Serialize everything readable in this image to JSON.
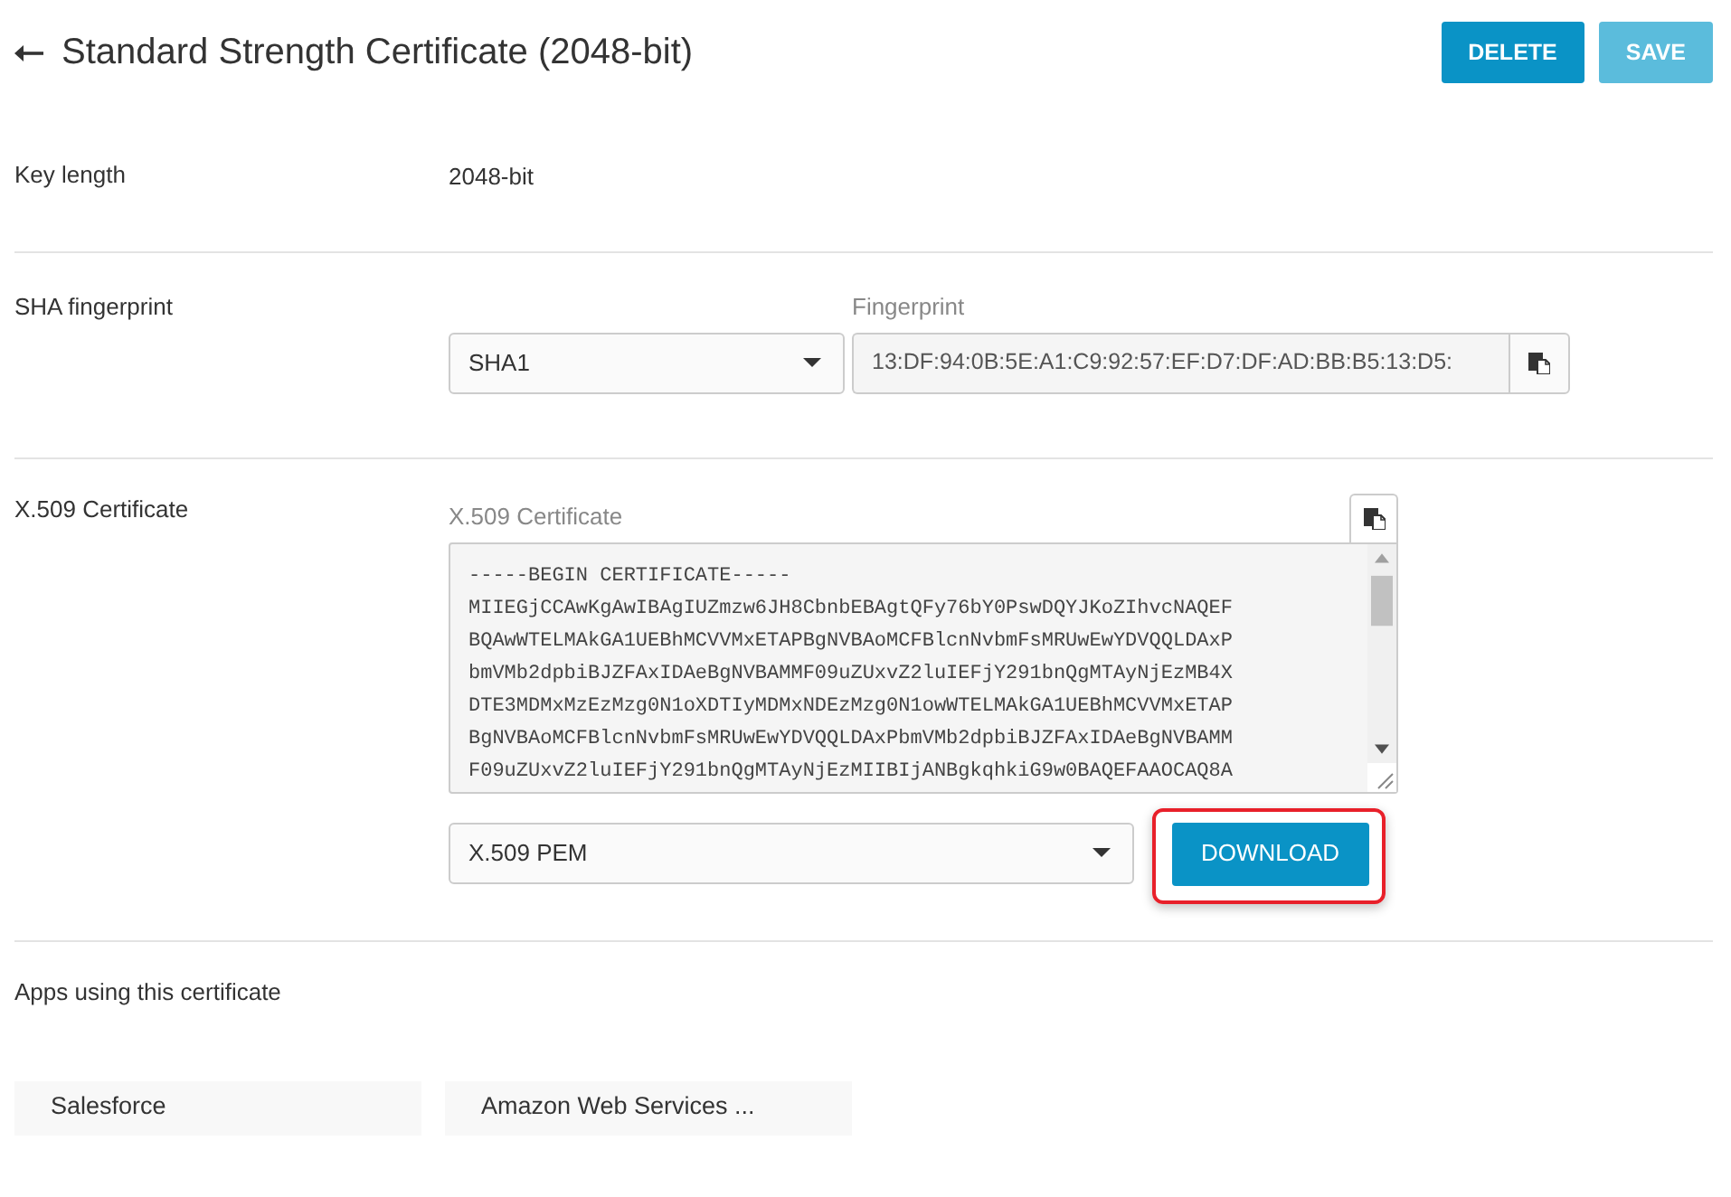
{
  "header": {
    "title": "Standard Strength Certificate (2048-bit)",
    "buttons": [
      {
        "label": "DELETE",
        "disabled": false
      },
      {
        "label": "SAVE",
        "disabled": true
      }
    ]
  },
  "sections": [
    {
      "kind": "value",
      "label": "Key length",
      "value": "2048-bit"
    },
    {
      "kind": "fingerprint",
      "label": "SHA fingerprint",
      "algorithm": "SHA1",
      "field_label": "Fingerprint",
      "fingerprint": "13:DF:94:0B:5E:A1:C9:92:57:EF:D7:DF:AD:BB:B5:13:D5:"
    },
    {
      "kind": "certificate",
      "label": "X.509 Certificate",
      "field_label": "X.509 Certificate",
      "lines": [
        "-----BEGIN CERTIFICATE-----",
        "MIIEGjCCAwKgAwIBAgIUZmzw6JH8CbnbEBAgtQFy76bY0PswDQYJKoZIhvcNAQEF",
        "BQAwWTELMAkGA1UEBhMCVVMxETAPBgNVBAoMCFBlcnNvbmFsMRUwEwYDVQQLDAxP",
        "bmVMb2dpbiBJZFAxIDAeBgNVBAMMF09uZUxvZ2luIEFjY291bnQgMTAyNjEzMB4X",
        "DTE3MDMxMzEzMzg0N1oXDTIyMDMxNDEzMzg0N1owWTELMAkGA1UEBhMCVVMxETAP",
        "BgNVBAoMCFBlcnNvbmFsMRUwEwYDVQQLDAxPbmVMb2dpbiBJZFAxIDAeBgNVBAMM",
        "F09uZUxvZ2luIEFjY291bnQgMTAyNjEzMIIBIjANBgkqhkiG9w0BAQEFAAOCAQ8A"
      ],
      "format": "X.509 PEM",
      "download": {
        "label": "DOWNLOAD",
        "highlighted": true
      }
    },
    {
      "kind": "apps",
      "label": "Apps using this certificate",
      "apps": [
        "Salesforce",
        "Amazon Web Services ..."
      ]
    }
  ]
}
